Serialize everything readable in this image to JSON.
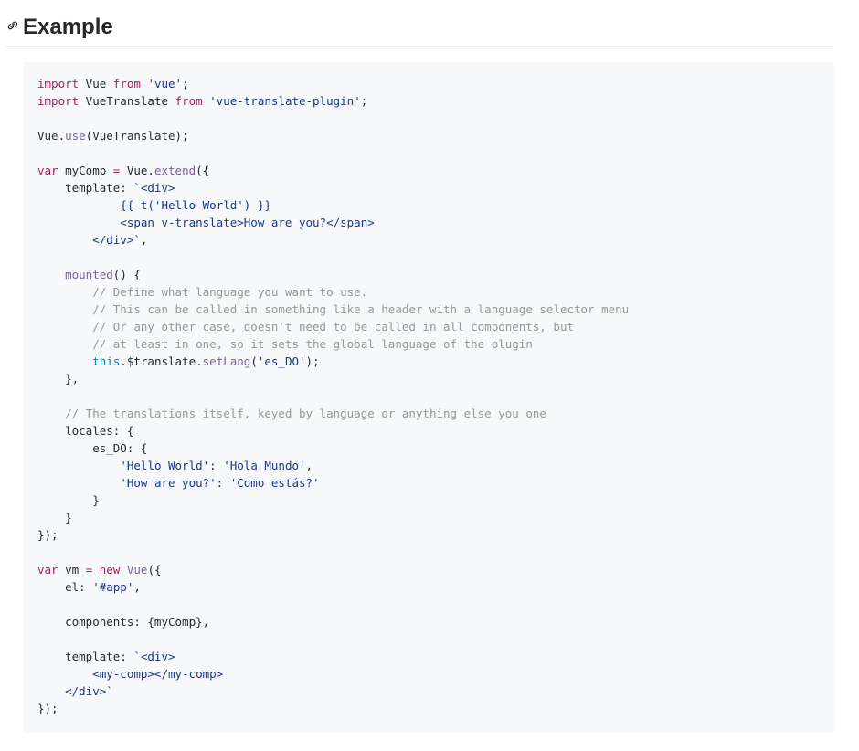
{
  "section": {
    "anchor_icon": "link-icon",
    "title": "Example"
  },
  "code": {
    "language": "javascript",
    "lines": [
      [
        {
          "t": "kw",
          "v": "import"
        },
        {
          "t": "",
          "v": " Vue "
        },
        {
          "t": "kw",
          "v": "from"
        },
        {
          "t": "",
          "v": " "
        },
        {
          "t": "str",
          "v": "'vue'"
        },
        {
          "t": "",
          "v": ";"
        }
      ],
      [
        {
          "t": "kw",
          "v": "import"
        },
        {
          "t": "",
          "v": " VueTranslate "
        },
        {
          "t": "kw",
          "v": "from"
        },
        {
          "t": "",
          "v": " "
        },
        {
          "t": "str",
          "v": "'vue-translate-plugin'"
        },
        {
          "t": "",
          "v": ";"
        }
      ],
      [],
      [
        {
          "t": "",
          "v": "Vue."
        },
        {
          "t": "fn",
          "v": "use"
        },
        {
          "t": "",
          "v": "(VueTranslate);"
        }
      ],
      [],
      [
        {
          "t": "kw",
          "v": "var"
        },
        {
          "t": "",
          "v": " myComp "
        },
        {
          "t": "kw",
          "v": "="
        },
        {
          "t": "",
          "v": " Vue."
        },
        {
          "t": "fn",
          "v": "extend"
        },
        {
          "t": "",
          "v": "({"
        }
      ],
      [
        {
          "t": "",
          "v": "    template: "
        },
        {
          "t": "str",
          "v": "`<div>"
        }
      ],
      [
        {
          "t": "str",
          "v": "            {{ t('Hello World') }}"
        }
      ],
      [
        {
          "t": "str",
          "v": "            <span v-translate>How are you?</span>"
        }
      ],
      [
        {
          "t": "str",
          "v": "        </div>`"
        },
        {
          "t": "",
          "v": ","
        }
      ],
      [],
      [
        {
          "t": "",
          "v": "    "
        },
        {
          "t": "fn",
          "v": "mounted"
        },
        {
          "t": "",
          "v": "() {"
        }
      ],
      [
        {
          "t": "com",
          "v": "        // Define what language you want to use."
        }
      ],
      [
        {
          "t": "com",
          "v": "        // This can be called in something like a header with a language selector menu"
        }
      ],
      [
        {
          "t": "com",
          "v": "        // Or any other case, doesn't need to be called in all components, but"
        }
      ],
      [
        {
          "t": "com",
          "v": "        // at least in one, so it sets the global language of the plugin"
        }
      ],
      [
        {
          "t": "",
          "v": "        "
        },
        {
          "t": "this",
          "v": "this"
        },
        {
          "t": "",
          "v": ".$translate."
        },
        {
          "t": "fn",
          "v": "setLang"
        },
        {
          "t": "",
          "v": "("
        },
        {
          "t": "str",
          "v": "'es_DO'"
        },
        {
          "t": "",
          "v": ");"
        }
      ],
      [
        {
          "t": "",
          "v": "    },"
        }
      ],
      [],
      [
        {
          "t": "com",
          "v": "    // The translations itself, keyed by language or anything else you one"
        }
      ],
      [
        {
          "t": "",
          "v": "    locales: {"
        }
      ],
      [
        {
          "t": "",
          "v": "        es_DO: {"
        }
      ],
      [
        {
          "t": "",
          "v": "            "
        },
        {
          "t": "str",
          "v": "'Hello World'"
        },
        {
          "t": "",
          "v": ": "
        },
        {
          "t": "str",
          "v": "'Hola Mundo'"
        },
        {
          "t": "",
          "v": ","
        }
      ],
      [
        {
          "t": "",
          "v": "            "
        },
        {
          "t": "str",
          "v": "'How are you?'"
        },
        {
          "t": "",
          "v": ": "
        },
        {
          "t": "str",
          "v": "'Como estás?'"
        }
      ],
      [
        {
          "t": "",
          "v": "        }"
        }
      ],
      [
        {
          "t": "",
          "v": "    }"
        }
      ],
      [
        {
          "t": "",
          "v": "});"
        }
      ],
      [],
      [
        {
          "t": "kw",
          "v": "var"
        },
        {
          "t": "",
          "v": " vm "
        },
        {
          "t": "kw",
          "v": "="
        },
        {
          "t": "",
          "v": " "
        },
        {
          "t": "kw",
          "v": "new"
        },
        {
          "t": "",
          "v": " "
        },
        {
          "t": "fn",
          "v": "Vue"
        },
        {
          "t": "",
          "v": "({"
        }
      ],
      [
        {
          "t": "",
          "v": "    el: "
        },
        {
          "t": "str",
          "v": "'#app'"
        },
        {
          "t": "",
          "v": ","
        }
      ],
      [],
      [
        {
          "t": "",
          "v": "    components: {myComp},"
        }
      ],
      [],
      [
        {
          "t": "",
          "v": "    template: "
        },
        {
          "t": "str",
          "v": "`<div>"
        }
      ],
      [
        {
          "t": "str",
          "v": "        <my-comp></my-comp>"
        }
      ],
      [
        {
          "t": "str",
          "v": "    </div>`"
        }
      ],
      [
        {
          "t": "",
          "v": "});"
        }
      ]
    ]
  },
  "colors": {
    "keyword": "#a71d5d",
    "string": "#183691",
    "comment": "#969896",
    "function": "#795da3",
    "this": "#0086b3",
    "code_background": "#f6f8fa",
    "heading_rule": "#eaecef"
  }
}
